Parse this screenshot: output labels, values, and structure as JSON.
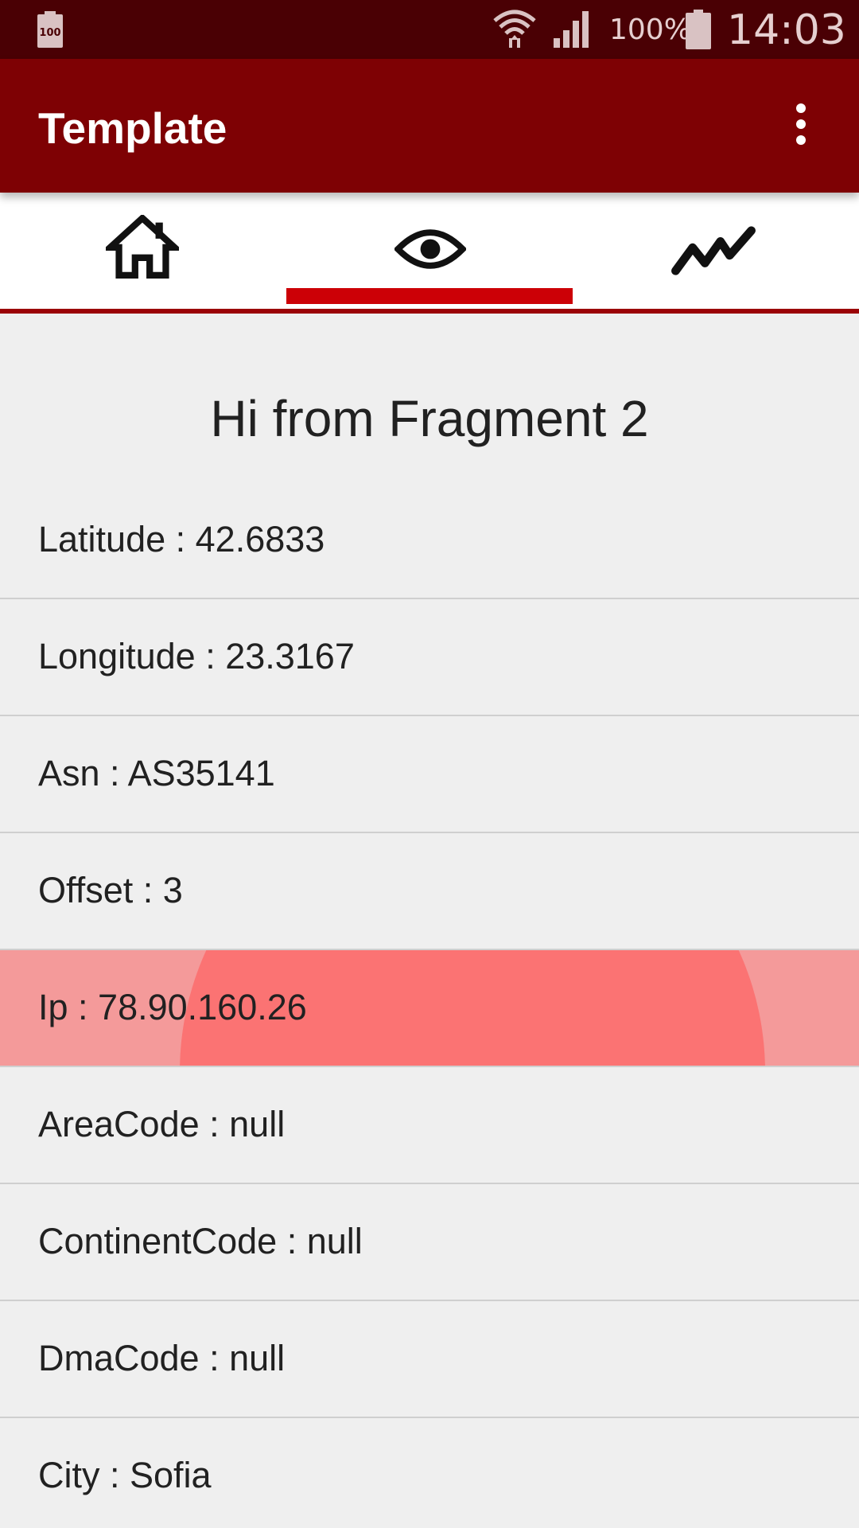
{
  "status_bar": {
    "battery_level_icon_text": "100",
    "battery_percent": "100%",
    "time": "14:03",
    "icons": [
      "battery-saver-icon",
      "wifi-icon",
      "signal-icon",
      "battery-icon"
    ]
  },
  "app_bar": {
    "title": "Template",
    "menu_icon": "overflow-menu-icon"
  },
  "tabs": [
    {
      "icon": "home-icon",
      "selected": false
    },
    {
      "icon": "eye-icon",
      "selected": true
    },
    {
      "icon": "trend-line-icon",
      "selected": false
    }
  ],
  "content": {
    "heading": "Hi from Fragment 2",
    "rows": [
      {
        "label": "Latitude : 42.6833"
      },
      {
        "label": "Longitude : 23.3167"
      },
      {
        "label": "Asn : AS35141"
      },
      {
        "label": "Offset : 3"
      },
      {
        "label": "Ip : 78.90.160.26",
        "pressed": true
      },
      {
        "label": "AreaCode : null"
      },
      {
        "label": "ContinentCode : null"
      },
      {
        "label": "DmaCode : null"
      },
      {
        "label": "City : Sofia"
      }
    ]
  },
  "colors": {
    "status_bar": "#4a0004",
    "app_bar": "#7e0104",
    "tab_indicator": "#cc0006",
    "pressed_row": "#f49a9a",
    "ripple": "#fb7373",
    "background": "#efefef"
  }
}
